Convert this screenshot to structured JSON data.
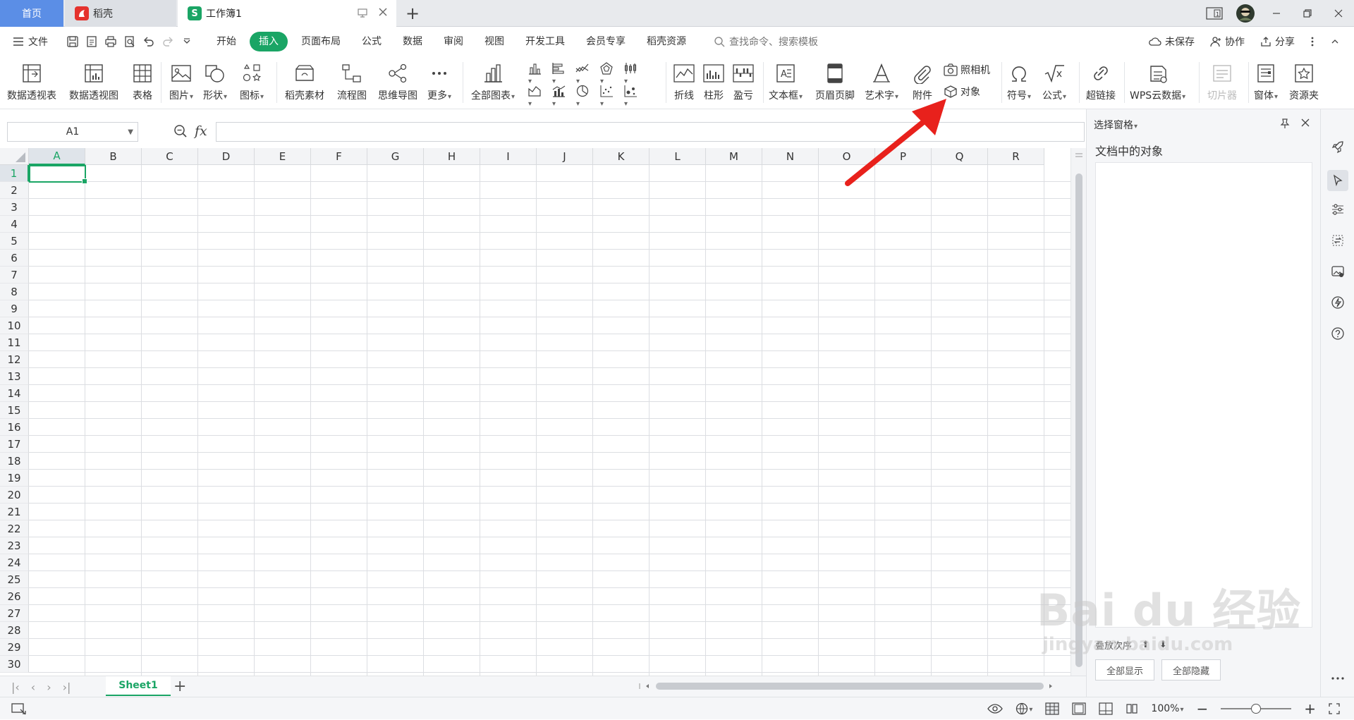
{
  "tabs": {
    "home": "首页",
    "daoke": "稻壳",
    "workbook": "工作簿1",
    "add": "+"
  },
  "menu": {
    "file": "文件",
    "tabs": [
      "开始",
      "插入",
      "页面布局",
      "公式",
      "数据",
      "审阅",
      "视图",
      "开发工具",
      "会员专享",
      "稻壳资源"
    ],
    "active_tab": "插入",
    "search_placeholder": "查找命令、搜索模板",
    "unsaved": "未保存",
    "collab": "协作",
    "share": "分享"
  },
  "ribbon": {
    "pivot_table": "数据透视表",
    "pivot_chart": "数据透视图",
    "table": "表格",
    "picture": "图片",
    "shape": "形状",
    "icon": "图标",
    "daoke_material": "稻壳素材",
    "flowchart": "流程图",
    "mindmap": "思维导图",
    "more": "更多",
    "all_charts": "全部图表",
    "line": "折线",
    "column": "柱形",
    "winloss": "盈亏",
    "textbox": "文本框",
    "header_footer": "页眉页脚",
    "wordart": "艺术字",
    "attachment": "附件",
    "camera": "照相机",
    "object": "对象",
    "symbol": "符号",
    "formula": "公式",
    "hyperlink": "超链接",
    "wps_cloud": "WPS云数据",
    "slicer": "切片器",
    "window": "窗体",
    "resource": "资源夹"
  },
  "formula_bar": {
    "name_box": "A1",
    "fx": "fx",
    "value": ""
  },
  "grid": {
    "columns": [
      "A",
      "B",
      "C",
      "D",
      "E",
      "F",
      "G",
      "H",
      "I",
      "J",
      "K",
      "L",
      "M",
      "N",
      "O",
      "P",
      "Q",
      "R"
    ],
    "rows": [
      "1",
      "2",
      "3",
      "4",
      "5",
      "6",
      "7",
      "8",
      "9",
      "10",
      "11",
      "12",
      "13",
      "14",
      "15",
      "16",
      "17",
      "18",
      "19",
      "20",
      "21",
      "22",
      "23",
      "24",
      "25",
      "26",
      "27",
      "28",
      "29",
      "30"
    ],
    "active_cell": "A1"
  },
  "sheets": {
    "names": [
      "Sheet1"
    ],
    "active": "Sheet1"
  },
  "status": {
    "zoom": "100%",
    "zoom_level": 0.5
  },
  "pane": {
    "title": "选择窗格",
    "subtitle": "文档中的对象",
    "order_label": "叠放次序",
    "show_all": "全部显示",
    "hide_all": "全部隐藏"
  },
  "watermark": {
    "main": "Bai du 经验",
    "sub": "jingyan.baidu.com"
  },
  "colors": {
    "accent_green": "#1aa565",
    "home_tab_blue": "#5b8ee6",
    "arrow_red": "#e8211c"
  }
}
